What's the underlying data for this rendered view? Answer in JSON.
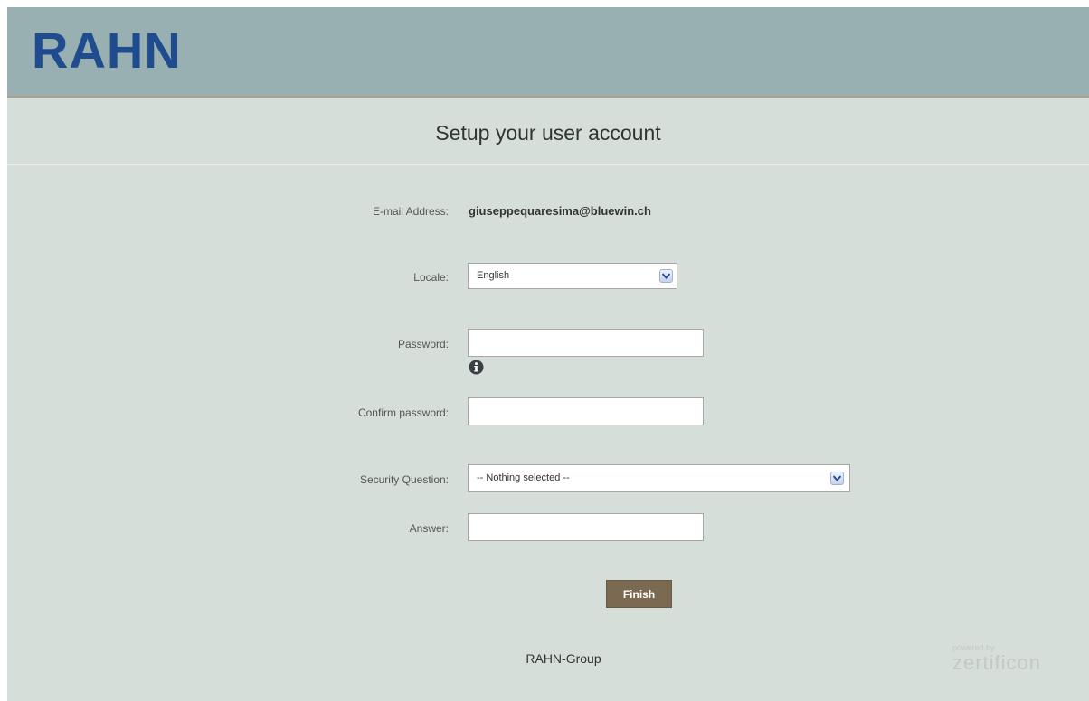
{
  "header": {
    "logo_text": "RAHN",
    "colors": {
      "logo": "#1e4c8f",
      "background": "#99b0b2"
    }
  },
  "page": {
    "title": "Setup your user account"
  },
  "form": {
    "email": {
      "label": "E-mail Address:",
      "value": "giuseppequaresima@bluewin.ch"
    },
    "locale": {
      "label": "Locale:",
      "selected": "English"
    },
    "password": {
      "label": "Password:",
      "value": ""
    },
    "confirm_password": {
      "label": "Confirm password:",
      "value": ""
    },
    "security_question": {
      "label": "Security Question:",
      "selected": "-- Nothing selected --"
    },
    "answer": {
      "label": "Answer:",
      "value": ""
    },
    "info_icon": "info-icon",
    "finish_label": "Finish",
    "colors": {
      "finish_button": "#7b6a51"
    }
  },
  "footer": {
    "company": "RAHN-Group",
    "powered_by": "powered by",
    "vendor": "zertificon"
  }
}
